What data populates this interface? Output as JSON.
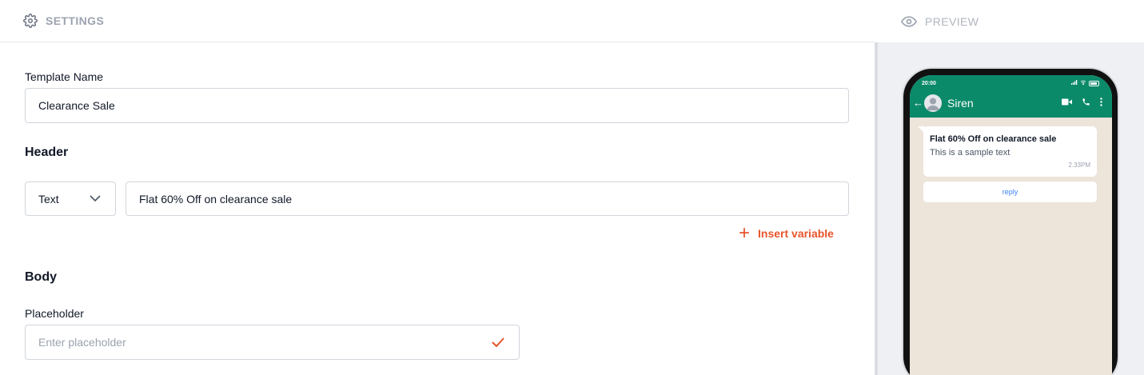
{
  "settings_header": {
    "label": "SETTINGS",
    "icon": "gear-icon"
  },
  "preview_header": {
    "label": "PREVIEW",
    "icon": "eye-icon"
  },
  "form": {
    "template_name": {
      "label": "Template Name",
      "value": "Clearance Sale"
    },
    "header": {
      "title": "Header",
      "type_select": {
        "value": "Text"
      },
      "text_value": "Flat 60% Off on clearance sale",
      "insert_variable_label": "Insert variable"
    },
    "body": {
      "title": "Body",
      "placeholder_label": "Placeholder",
      "placeholder_input": {
        "placeholder": "Enter placeholder",
        "value": ""
      }
    }
  },
  "preview": {
    "status_time": "20:00",
    "contact_name": "Siren",
    "message": {
      "title": "Flat 60% Off on clearance sale",
      "text": "This is a sample text",
      "time": "2.33PM"
    },
    "reply_label": "reply"
  },
  "colors": {
    "accent": "#e8542b",
    "whatsapp_green": "#0b8a6a",
    "chat_background": "#ede4da"
  }
}
